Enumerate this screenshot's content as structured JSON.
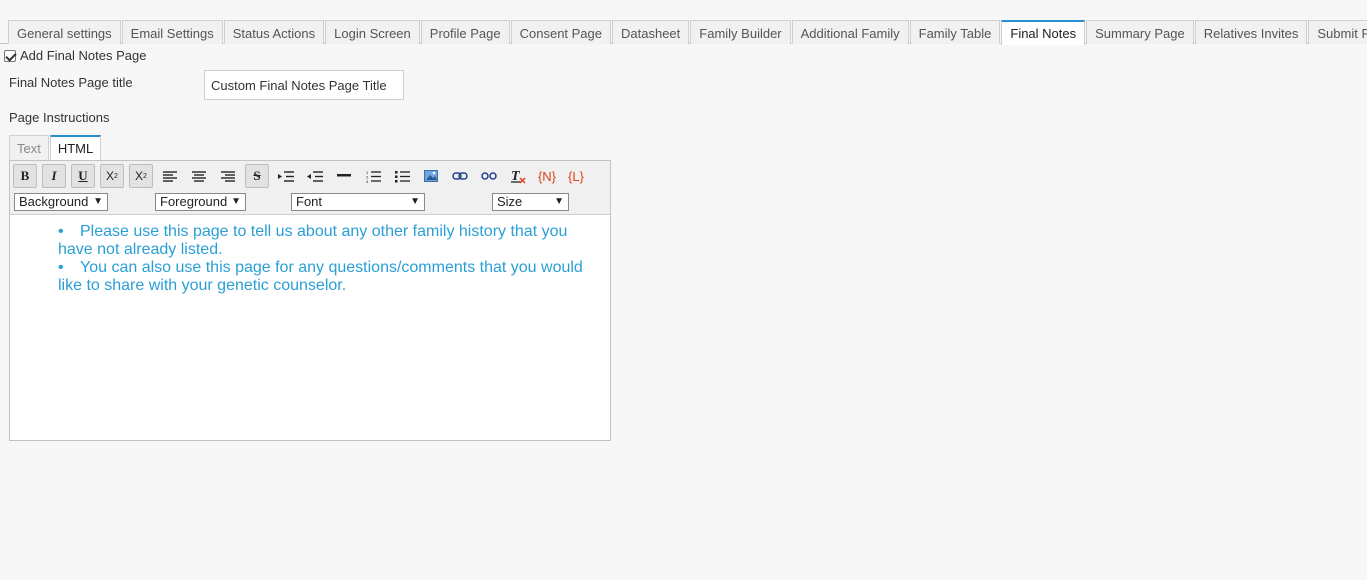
{
  "tabs": [
    {
      "label": "General settings"
    },
    {
      "label": "Email Settings"
    },
    {
      "label": "Status Actions"
    },
    {
      "label": "Login Screen"
    },
    {
      "label": "Profile Page"
    },
    {
      "label": "Consent Page"
    },
    {
      "label": "Datasheet"
    },
    {
      "label": "Family Builder"
    },
    {
      "label": "Additional Family"
    },
    {
      "label": "Family Table"
    },
    {
      "label": "Final Notes"
    },
    {
      "label": "Summary Page"
    },
    {
      "label": "Relatives Invites"
    },
    {
      "label": "Submit Page"
    }
  ],
  "active_tab": "Final Notes",
  "form": {
    "add_page_label": "Add Final Notes Page",
    "add_page_checked": true,
    "title_label": "Final Notes Page title",
    "title_value": "Custom Final Notes Page Title",
    "instructions_label": "Page Instructions"
  },
  "editor": {
    "tabs": [
      {
        "label": "Text"
      },
      {
        "label": "HTML"
      }
    ],
    "active_tab": "HTML",
    "toolbar": {
      "bold": "B",
      "italic": "I",
      "underline": "U",
      "subscript": "X",
      "sub_mark": "2",
      "superscript": "X",
      "sup_mark": "2",
      "strike": "S",
      "token_name": "{N}",
      "token_link": "{L}"
    },
    "selects": {
      "background": "Background",
      "foreground": "Foreground",
      "font": "Font",
      "size": "Size"
    },
    "content": [
      "Please use this page to tell us about any other family history that you have not already listed.",
      "You can also use this page for any questions/comments that you would like to share with your genetic counselor."
    ]
  },
  "colors": {
    "accent": "#2a8fd0",
    "content_text": "#2a9fd6",
    "token_red": "#e0431a"
  }
}
